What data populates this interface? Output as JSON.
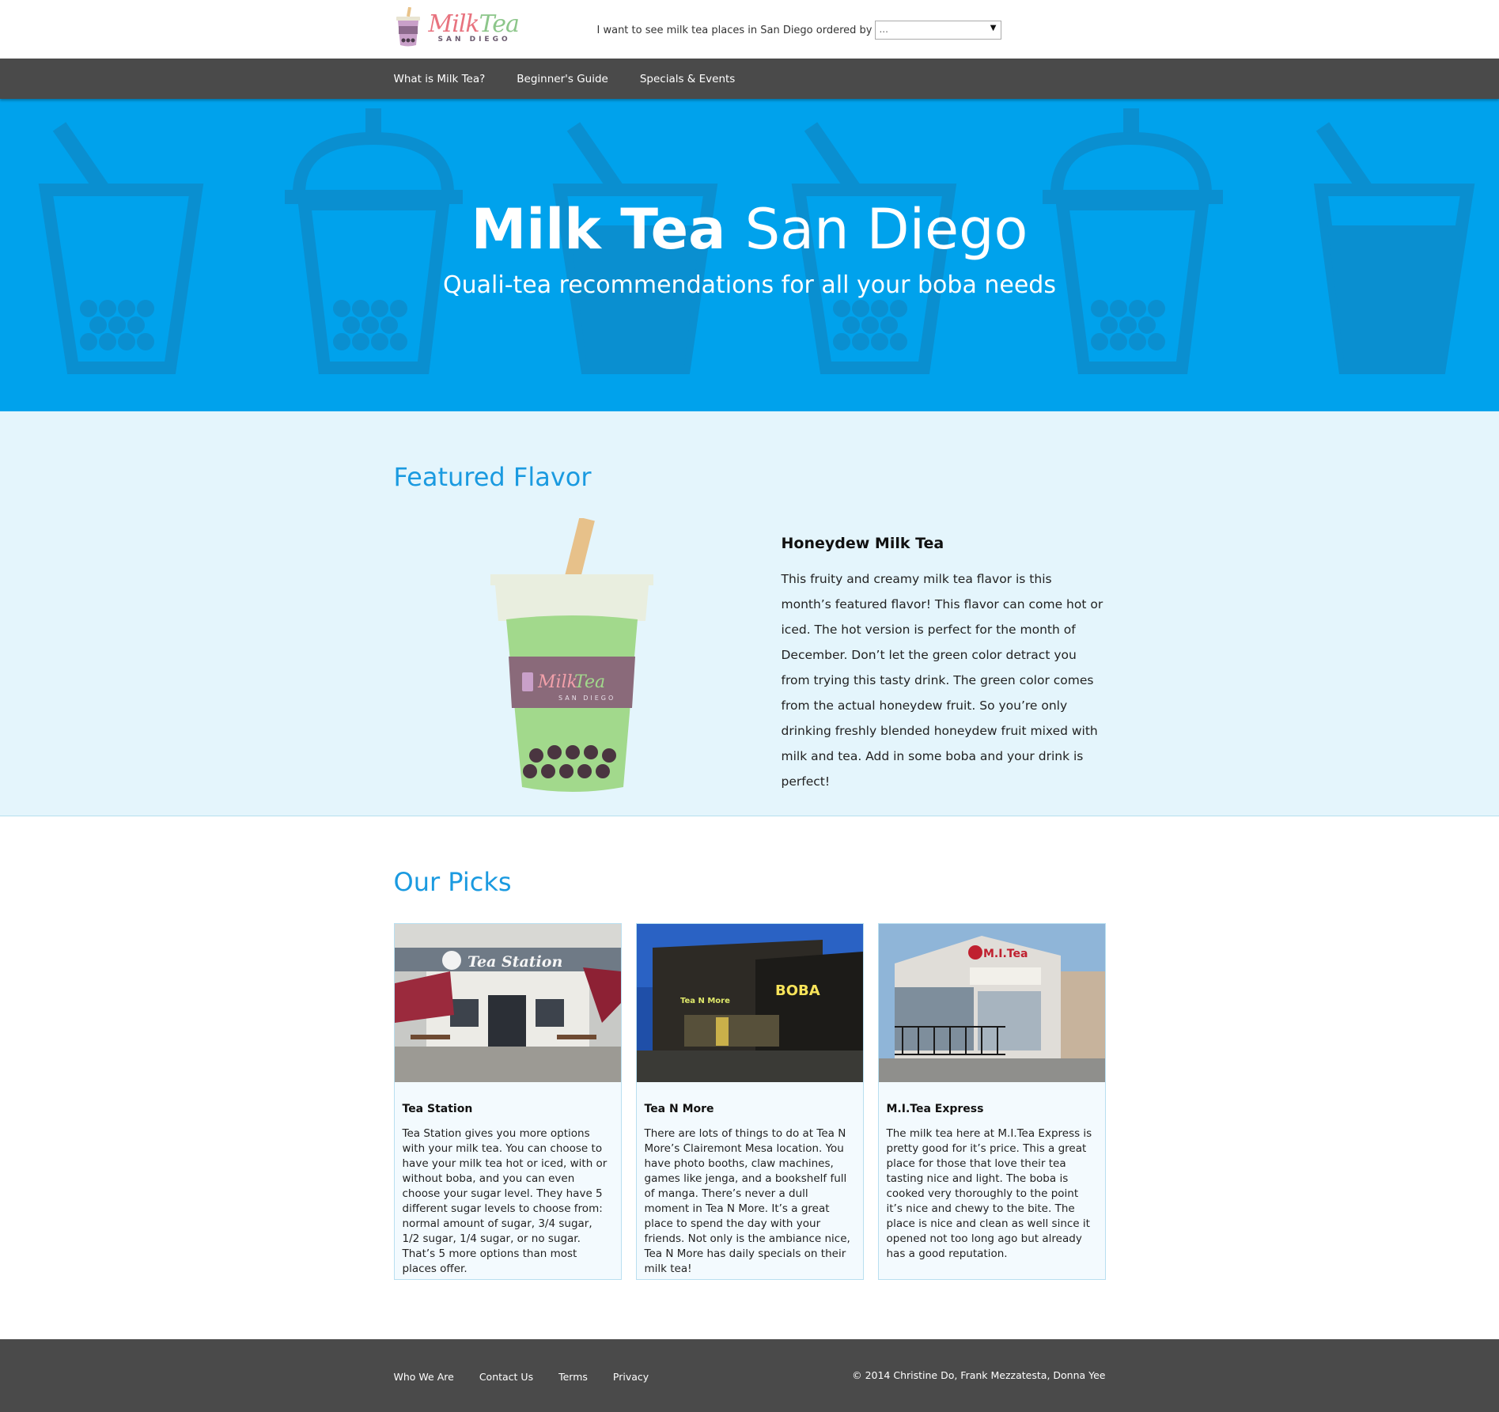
{
  "header": {
    "logo": {
      "word_milk": "Milk",
      "word_tea": "Tea",
      "sub": "SAN DIEGO"
    },
    "order_label": "I want to see milk tea places in San Diego ordered by",
    "order_select": {
      "value": "...",
      "arrow": "▼"
    }
  },
  "nav": {
    "items": [
      {
        "label": "What is Milk Tea?"
      },
      {
        "label": "Beginner's Guide"
      },
      {
        "label": "Specials & Events"
      }
    ]
  },
  "hero": {
    "title_bold": "Milk Tea",
    "title_light": "San Diego",
    "subtitle": "Quali-tea recommendations for all your boba needs"
  },
  "featured": {
    "section_title": "Featured Flavor",
    "flavor_name": "Honeydew Milk Tea",
    "flavor_desc": "This fruity and creamy milk tea flavor is this month’s featured flavor! This flavor can come hot or iced. The hot version is perfect for the month of December. Don’t let the green color detract you from trying this tasty drink. The green color comes from the actual honeydew fruit. So you’re only drinking freshly blended honeydew fruit mixed with milk and tea. Add in some boba and your drink is perfect!",
    "cup_label": {
      "milk": "Milk",
      "tea": "Tea",
      "sub": "SAN DIEGO"
    }
  },
  "picks": {
    "section_title": "Our Picks",
    "cards": [
      {
        "name": "Tea Station",
        "sign": "Tea Station",
        "desc": "Tea Station gives you more options with your milk tea. You can choose to have your milk tea hot or iced, with or without boba, and you can even choose your sugar level. They have 5 different sugar levels to choose from: normal amount of sugar, 3/4 sugar, 1/2 sugar, 1/4 sugar, or no sugar. That’s 5 more options than most places offer."
      },
      {
        "name": "Tea N More",
        "sign": "BOBA",
        "sign2": "Tea N More",
        "desc": "There are lots of things to do at Tea N More’s Clairemont Mesa location. You have photo booths, claw machines, games like jenga, and a bookshelf full of manga. There’s never a dull moment in Tea N More. It’s a great place to spend the day with your friends. Not only is the ambiance nice, Tea N More has daily specials on their milk tea!"
      },
      {
        "name": "M.I.Tea Express",
        "sign": "M.I.Tea",
        "desc": "The milk tea here at M.I.Tea Express is pretty good for it’s price. This a great place for those that love their tea tasting nice and light. The boba is cooked very thoroughly to the point it’s nice and chewy to the bite. The place is nice and clean as well since it opened not too long ago but already has a good reputation."
      }
    ]
  },
  "footer": {
    "links": [
      {
        "label": "Who We Are"
      },
      {
        "label": "Contact Us"
      },
      {
        "label": "Terms"
      },
      {
        "label": "Privacy"
      }
    ],
    "copyright": "© 2014 Christine Do, Frank Mezzatesta, Donna Yee"
  },
  "colors": {
    "hero_bg": "#00a2ec",
    "hero_shapes": "#0a8fd0",
    "accent": "#1a9ae0",
    "nav_bg": "#4a4a4a",
    "featured_bg": "#e4f5fc"
  },
  "icons": [
    "boba-cup-icon",
    "dropdown-arrow-icon"
  ]
}
